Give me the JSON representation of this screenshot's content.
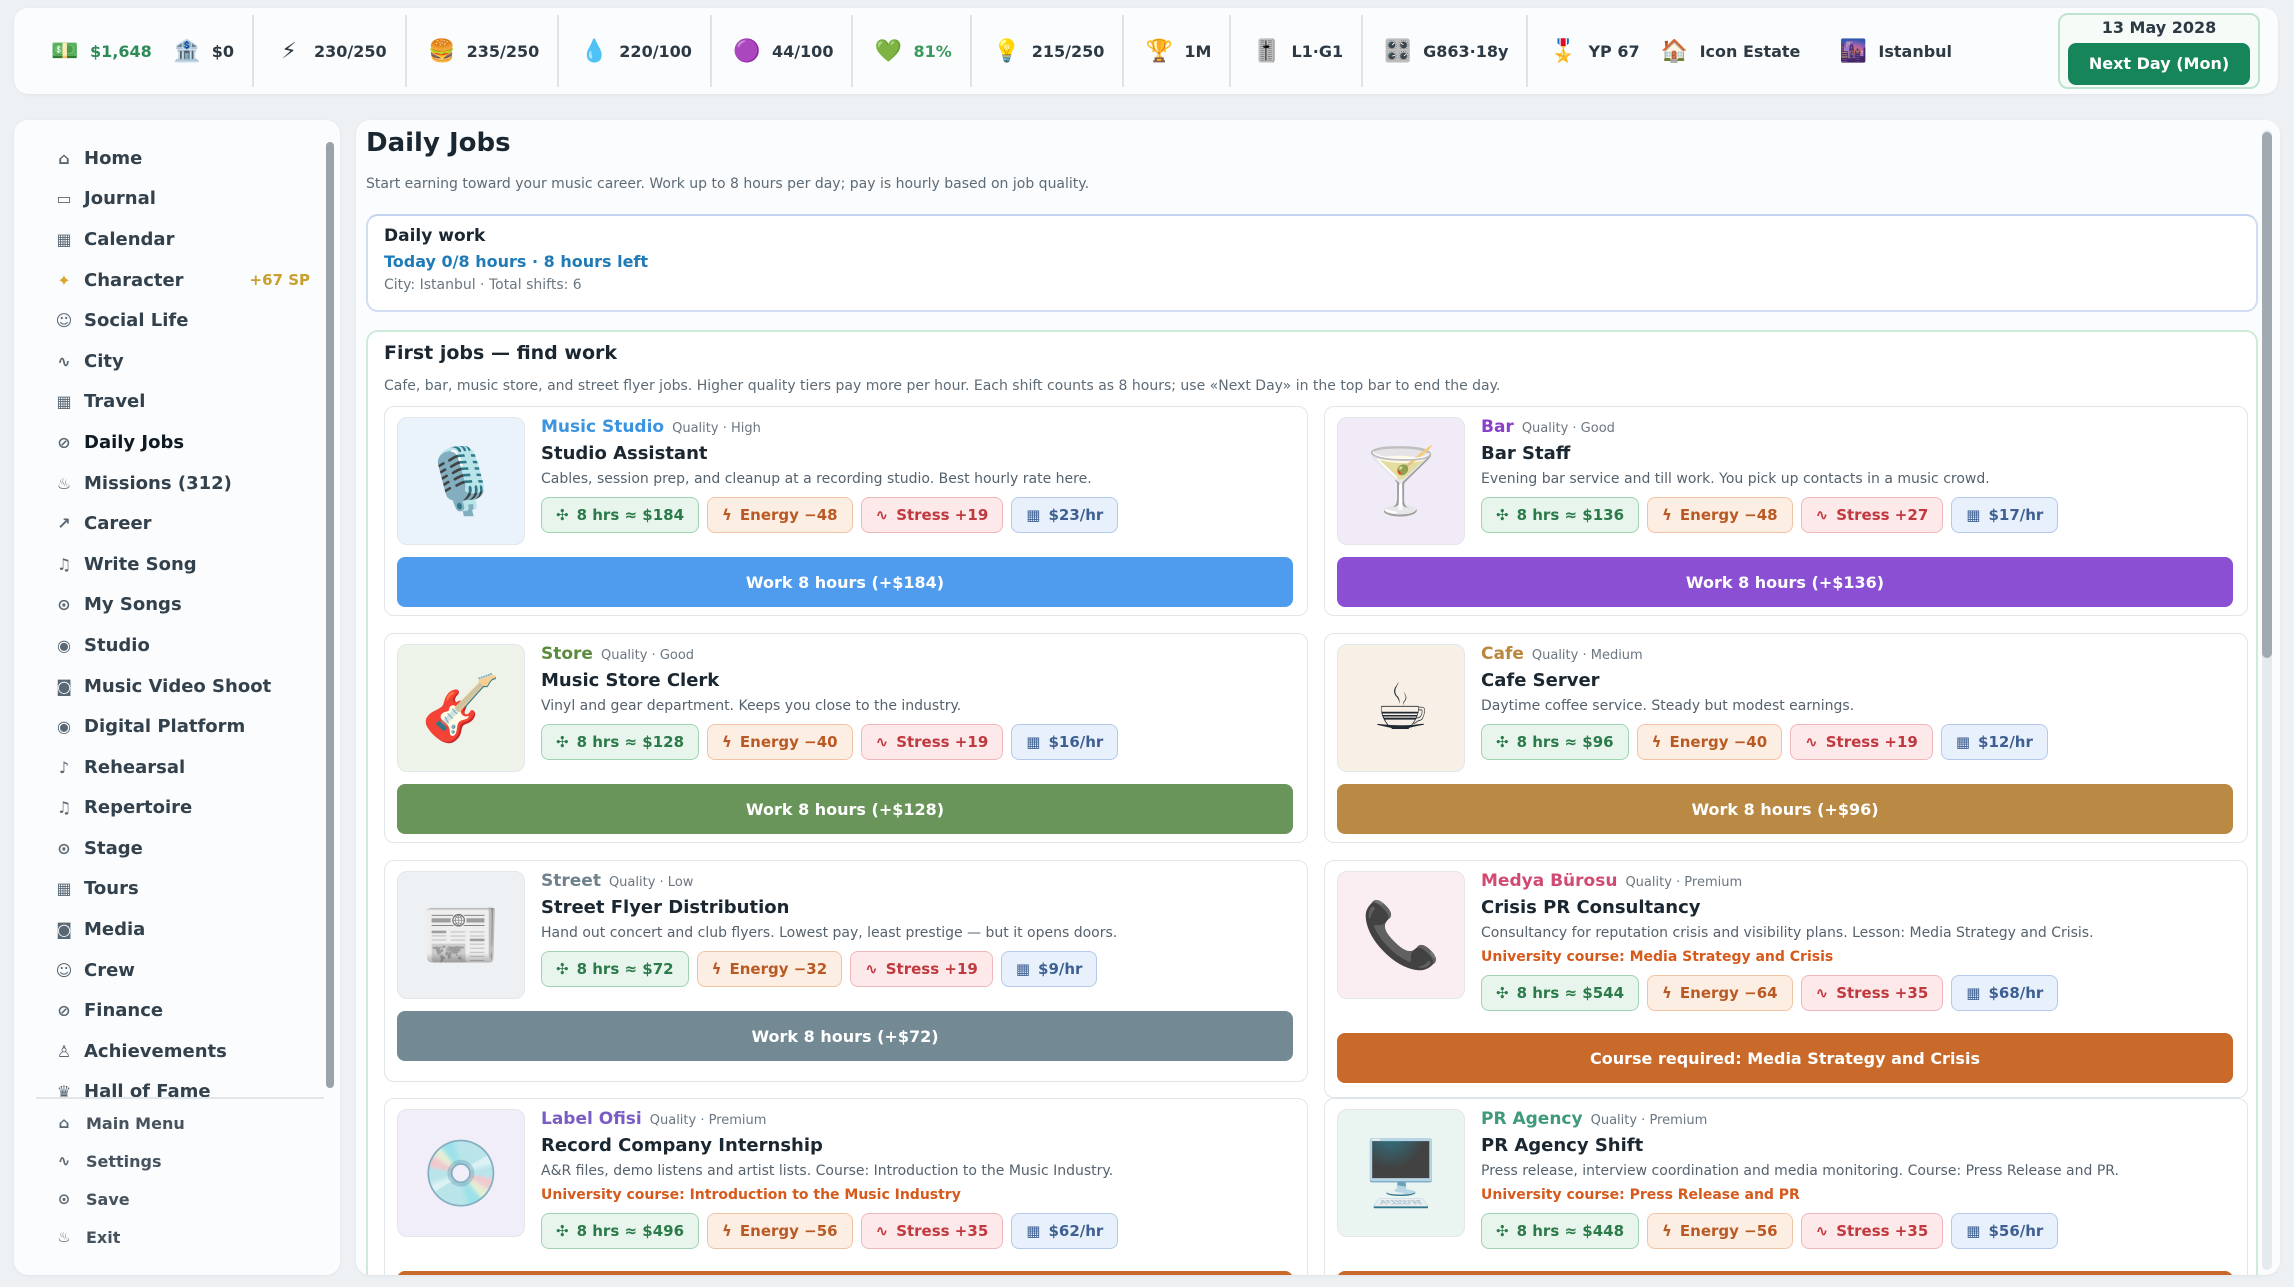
{
  "topbar": {
    "stats": [
      {
        "name": "money",
        "icon": "💵",
        "value": "$1,648"
      },
      {
        "name": "bank",
        "icon": "🏦",
        "value": "$0"
      },
      {
        "name": "energy",
        "icon": "⚡",
        "value": "230/250"
      },
      {
        "name": "food",
        "icon": "🍔",
        "value": "235/250"
      },
      {
        "name": "water",
        "icon": "💧",
        "value": "220/100"
      },
      {
        "name": "stress",
        "icon": "🟣",
        "value": "44/100"
      },
      {
        "name": "health",
        "icon": "💚",
        "value": "81%"
      },
      {
        "name": "inspiration",
        "icon": "💡",
        "value": "215/250"
      },
      {
        "name": "fans",
        "icon": "🏆",
        "value": "1M"
      },
      {
        "name": "level",
        "icon": "🎚️",
        "value": "L1·G1"
      },
      {
        "name": "genre",
        "icon": "🎛️",
        "value": "G863·18y"
      },
      {
        "name": "yp",
        "icon": "🎖️",
        "value": "YP 67"
      },
      {
        "name": "estate",
        "icon": "🏠",
        "value": "Icon Estate"
      },
      {
        "name": "city",
        "icon": "🌆",
        "value": "Istanbul"
      }
    ],
    "date": "13 May 2028",
    "next_day_label": "Next Day (Mon)"
  },
  "sidebar": {
    "items": [
      {
        "label": "Home",
        "icon": "⌂"
      },
      {
        "label": "Journal",
        "icon": "▭"
      },
      {
        "label": "Calendar",
        "icon": "▦"
      },
      {
        "label": "Character",
        "icon": "✦",
        "badge": "+67 SP"
      },
      {
        "label": "Social Life",
        "icon": "☺"
      },
      {
        "label": "City",
        "icon": "∿"
      },
      {
        "label": "Travel",
        "icon": "▦"
      },
      {
        "label": "Daily Jobs",
        "icon": "⊘"
      },
      {
        "label": "Missions (312)",
        "icon": "♨"
      },
      {
        "label": "Career",
        "icon": "↗"
      },
      {
        "label": "Write Song",
        "icon": "♫"
      },
      {
        "label": "My Songs",
        "icon": "⊙"
      },
      {
        "label": "Studio",
        "icon": "◉"
      },
      {
        "label": "Music Video Shoot",
        "icon": "◙"
      },
      {
        "label": "Digital Platform",
        "icon": "◉"
      },
      {
        "label": "Rehearsal",
        "icon": "♪"
      },
      {
        "label": "Repertoire",
        "icon": "♫"
      },
      {
        "label": "Stage",
        "icon": "⊙"
      },
      {
        "label": "Tours",
        "icon": "▦"
      },
      {
        "label": "Media",
        "icon": "◙"
      },
      {
        "label": "Crew",
        "icon": "☺"
      },
      {
        "label": "Finance",
        "icon": "⊘"
      },
      {
        "label": "Achievements",
        "icon": "♙"
      },
      {
        "label": "Hall of Fame",
        "icon": "♛"
      }
    ],
    "bottom": [
      {
        "label": "Main Menu",
        "icon": "⌂"
      },
      {
        "label": "Settings",
        "icon": "∿"
      },
      {
        "label": "Save",
        "icon": "⊙"
      },
      {
        "label": "Exit",
        "icon": "♨"
      }
    ]
  },
  "page": {
    "title": "Daily Jobs",
    "subtitle": "Start earning toward your music career. Work up to 8 hours per day; pay is hourly based on job quality."
  },
  "daily_work": {
    "heading": "Daily work",
    "today": "Today 0/8 hours · 8 hours left",
    "meta": "City: Istanbul · Total shifts: 6"
  },
  "first_jobs": {
    "title": "First jobs — find work",
    "subtitle": "Cafe, bar, music store, and street flyer jobs. Higher quality tiers pay more per hour. Each shift counts as 8 hours; use «Next Day» in the top bar to end the day."
  },
  "jobs": [
    {
      "category": "Music Studio",
      "quality": "Quality · High",
      "title": "Studio Assistant",
      "desc": "Cables, session prep, and cleanup at a recording studio. Best hourly rate here.",
      "course": "",
      "pay": "8 hrs ≈ $184",
      "energy": "Energy −48",
      "stress": "Stress +19",
      "rate": "$23/hr",
      "button": "Work 8 hours (+$184)",
      "cat_color": "#3b94e0",
      "btn_color": "#4f9cee",
      "thumb_bg": "#eaf3fb",
      "emoji": "🎙️"
    },
    {
      "category": "Bar",
      "quality": "Quality · Good",
      "title": "Bar Staff",
      "desc": "Evening bar service and till work. You pick up contacts in a music crowd.",
      "course": "",
      "pay": "8 hrs ≈ $136",
      "energy": "Energy −48",
      "stress": "Stress +27",
      "rate": "$17/hr",
      "button": "Work 8 hours (+$136)",
      "cat_color": "#8a3fc9",
      "btn_color": "#8b4fd3",
      "thumb_bg": "#f1ebf8",
      "emoji": "🍸"
    },
    {
      "category": "Store",
      "quality": "Quality · Good",
      "title": "Music Store Clerk",
      "desc": "Vinyl and gear department. Keeps you close to the industry.",
      "course": "",
      "pay": "8 hrs ≈ $128",
      "energy": "Energy −40",
      "stress": "Stress +19",
      "rate": "$16/hr",
      "button": "Work 8 hours (+$128)",
      "cat_color": "#5c8a3f",
      "btn_color": "#6a955a",
      "thumb_bg": "#eef3ea",
      "emoji": "🎸"
    },
    {
      "category": "Cafe",
      "quality": "Quality · Medium",
      "title": "Cafe Server",
      "desc": "Daytime coffee service. Steady but modest earnings.",
      "course": "",
      "pay": "8 hrs ≈ $96",
      "energy": "Energy −40",
      "stress": "Stress +19",
      "rate": "$12/hr",
      "button": "Work 8 hours (+$96)",
      "cat_color": "#b9863b",
      "btn_color": "#ba8a45",
      "thumb_bg": "#f8f0e6",
      "emoji": "☕"
    },
    {
      "category": "Street",
      "quality": "Quality · Low",
      "title": "Street Flyer Distribution",
      "desc": "Hand out concert and club flyers. Lowest pay, least prestige — but it opens doors.",
      "course": "",
      "pay": "8 hrs ≈ $72",
      "energy": "Energy −32",
      "stress": "Stress +19",
      "rate": "$9/hr",
      "button": "Work 8 hours (+$72)",
      "cat_color": "#6f818c",
      "btn_color": "#738993",
      "thumb_bg": "#eef1f3",
      "emoji": "📰"
    },
    {
      "category": "Medya Bürosu",
      "quality": "Quality · Premium",
      "title": "Crisis PR Consultancy",
      "desc": "Consultancy for reputation crisis and visibility plans. Lesson: Media Strategy and Crisis.",
      "course": "University course: Media Strategy and Crisis",
      "pay": "8 hrs ≈ $544",
      "energy": "Energy −64",
      "stress": "Stress +35",
      "rate": "$68/hr",
      "button": "Course required: Media Strategy and Crisis",
      "cat_color": "#d14a72",
      "btn_color": "#c9692a",
      "thumb_bg": "#fbeef2",
      "emoji": "📞"
    },
    {
      "category": "Label Ofisi",
      "quality": "Quality · Premium",
      "title": "Record Company Internship",
      "desc": "A&R files, demo listens and artist lists. Course: Introduction to the Music Industry.",
      "course": "University course: Introduction to the Music Industry",
      "pay": "8 hrs ≈ $496",
      "energy": "Energy −56",
      "stress": "Stress +35",
      "rate": "$62/hr",
      "button": "",
      "cat_color": "#7a5cc4",
      "btn_color": "#c9692a",
      "thumb_bg": "#f1edf9",
      "emoji": "💿"
    },
    {
      "category": "PR Agency",
      "quality": "Quality · Premium",
      "title": "PR Agency Shift",
      "desc": "Press release, interview coordination and media monitoring. Course: Press Release and PR.",
      "course": "University course: Press Release and PR",
      "pay": "8 hrs ≈ $448",
      "energy": "Energy −56",
      "stress": "Stress +35",
      "rate": "$56/hr",
      "button": "",
      "cat_color": "#3f9a7a",
      "btn_color": "#c9692a",
      "thumb_bg": "#eaf5f1",
      "emoji": "🖥️"
    }
  ]
}
